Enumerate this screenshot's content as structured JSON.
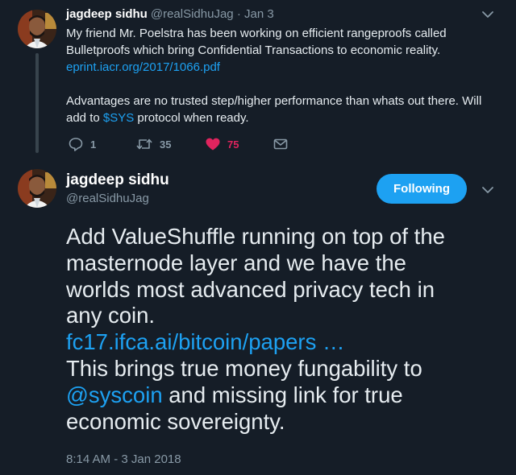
{
  "parent_tweet": {
    "author_name": "jagdeep sidhu",
    "meta": "@realSidhuJag · Jan 3",
    "text_lines": [
      "My friend Mr. Poelstra has been working on efficient rangeproofs called",
      "Bulletproofs which bring Confidential Transactions to economic reality."
    ],
    "link": "eprint.iacr.org/2017/1066.pdf",
    "text_lines_2": [
      "Advantages are no trusted step/higher performance than whats out there. Will"
    ],
    "last_line_prefix": "add to ",
    "cashtag": "$SYS",
    "last_line_suffix": " protocol when ready.",
    "actions": {
      "reply_icon": "reply-icon",
      "reply_count": "1",
      "retweet_icon": "retweet-icon",
      "retweet_count": "35",
      "like_icon": "heart-icon",
      "like_count": "75",
      "dm_icon": "envelope-icon"
    }
  },
  "focused_tweet": {
    "author_name": "jagdeep sidhu",
    "handle": "@realSidhuJag",
    "follow_label": "Following",
    "lines": [
      "Add ValueShuffle running on top of the",
      "masternode layer and we have the",
      "worlds most advanced privacy tech in",
      "any coin."
    ],
    "link": "fc17.ifca.ai/bitcoin/papers …",
    "line_after_link": "This brings true money fungability to",
    "mention": "@syscoin",
    "mention_suffix": " and missing link for true",
    "final_line": "economic sovereignty.",
    "timestamp": "8:14 AM - 3 Jan 2018"
  },
  "colors": {
    "background": "#151d27",
    "accent": "#1da1f2",
    "like": "#e0245e",
    "muted": "#8899a6",
    "text": "#e6ecf0"
  }
}
